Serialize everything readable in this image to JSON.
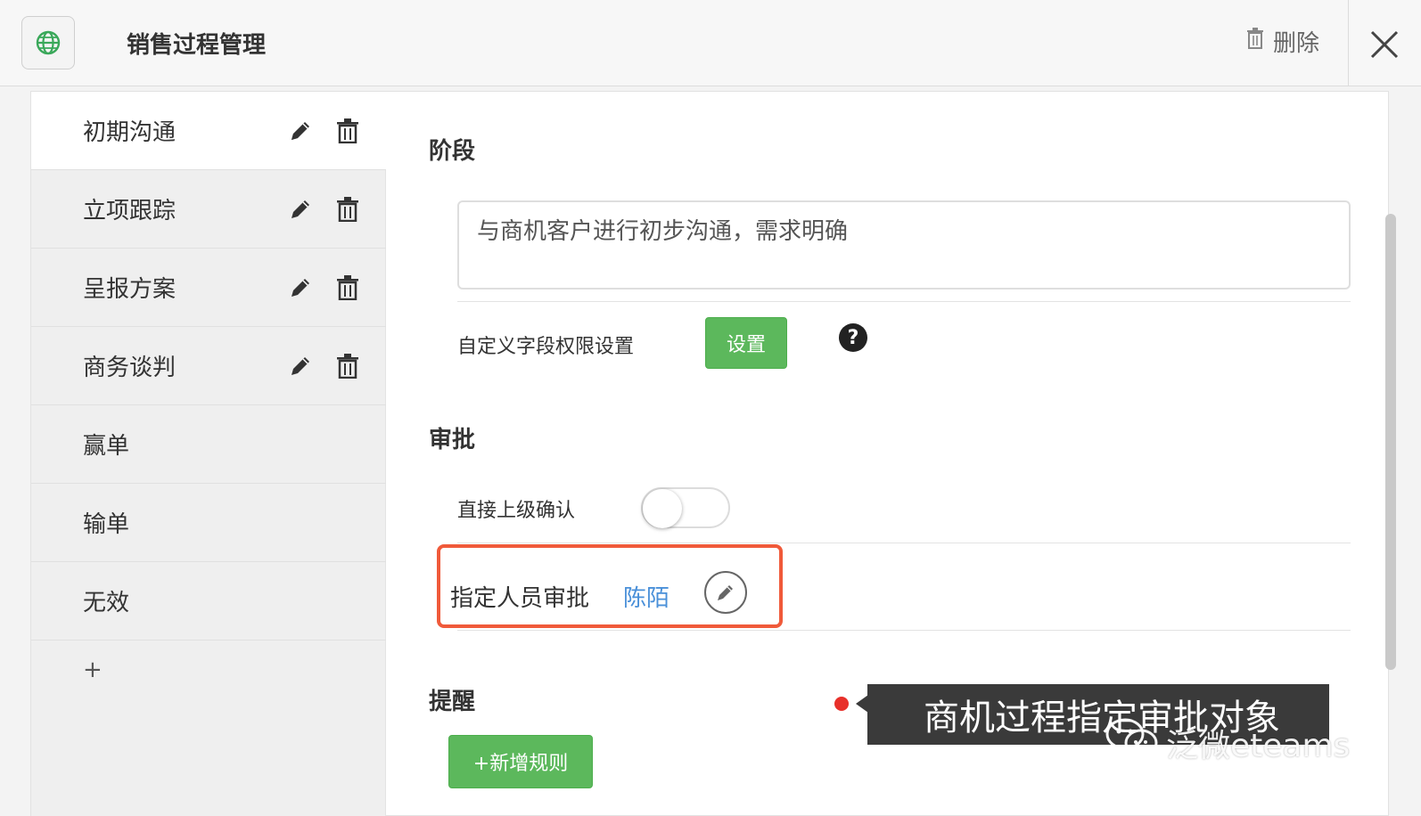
{
  "header": {
    "title": "销售过程管理",
    "app_icon": "globe-icon",
    "delete_label": "删除",
    "delete_icon": "trash-icon",
    "close_icon": "close-icon"
  },
  "sidebar": {
    "stages": [
      {
        "label": "初期沟通",
        "editable": true,
        "active": true
      },
      {
        "label": "立项跟踪",
        "editable": true
      },
      {
        "label": "呈报方案",
        "editable": true
      },
      {
        "label": "商务谈判",
        "editable": true
      },
      {
        "label": "赢单",
        "editable": false
      },
      {
        "label": "输单",
        "editable": false
      },
      {
        "label": "无效",
        "editable": false
      }
    ],
    "add_label": "+"
  },
  "stage_section": {
    "title": "阶段",
    "description": "与商机客户进行初步沟通，需求明确",
    "custom_field_label": "自定义字段权限设置",
    "set_button": "设置",
    "help_icon": "question-circle-icon",
    "help_glyph": "?"
  },
  "approval_section": {
    "title": "审批",
    "direct_superior_label": "直接上级确认",
    "direct_superior_enabled": false,
    "designated_label": "指定人员审批",
    "designated_person": "陈陌"
  },
  "reminder_section": {
    "title": "提醒",
    "add_rule_button": "+新增规则"
  },
  "overlay": {
    "caption": "商机过程指定审批对象",
    "watermark": "泛微eteams",
    "watermark_icon": "wechat-icon"
  },
  "colors": {
    "accent_green": "#5cb85c",
    "highlight_red": "#f05a3a",
    "link_blue": "#4a90d9"
  }
}
